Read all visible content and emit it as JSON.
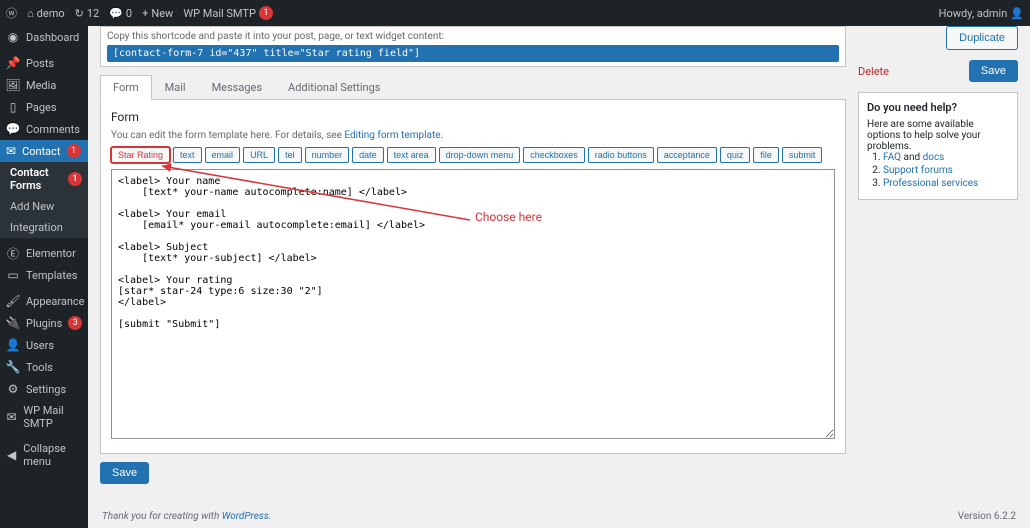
{
  "adminbar": {
    "site": "demo",
    "updates": "12",
    "comments": "0",
    "new": "New",
    "smtp": "WP Mail SMTP",
    "smtp_badge": "1",
    "howdy": "Howdy, admin"
  },
  "sidebar": {
    "items": [
      {
        "icon": "⌂",
        "label": "Dashboard"
      },
      {
        "icon": "✎",
        "label": "Posts"
      },
      {
        "icon": "▤",
        "label": "Media"
      },
      {
        "icon": "▯",
        "label": "Pages"
      },
      {
        "icon": "✉",
        "label": "Comments"
      },
      {
        "icon": "✉",
        "label": "Contact",
        "badge": "1",
        "active": true
      },
      {
        "icon": "Ⓔ",
        "label": "Elementor"
      },
      {
        "icon": "▭",
        "label": "Templates"
      },
      {
        "icon": "✐",
        "label": "Appearance"
      },
      {
        "icon": "⚙",
        "label": "Plugins",
        "badge": "3"
      },
      {
        "icon": "👤",
        "label": "Users"
      },
      {
        "icon": "🔧",
        "label": "Tools"
      },
      {
        "icon": "⚙",
        "label": "Settings"
      },
      {
        "icon": "✉",
        "label": "WP Mail SMTP"
      },
      {
        "icon": "◀",
        "label": "Collapse menu"
      }
    ],
    "submenu": {
      "title": "Contact Forms",
      "badge": "1",
      "items": [
        "Add New",
        "Integration"
      ]
    }
  },
  "shortcode": {
    "hint": "Copy this shortcode and paste it into your post, page, or text widget content:",
    "value": "[contact-form-7 id=\"437\" title=\"Star rating field\"]"
  },
  "tabs": [
    "Form",
    "Mail",
    "Messages",
    "Additional Settings"
  ],
  "form": {
    "heading": "Form",
    "hint_pre": "You can edit the form template here. For details, see ",
    "hint_link": "Editing form template",
    "tags": [
      "Star Rating",
      "text",
      "email",
      "URL",
      "tel",
      "number",
      "date",
      "text area",
      "drop-down menu",
      "checkboxes",
      "radio buttons",
      "acceptance",
      "quiz",
      "file",
      "submit"
    ],
    "content": "<label> Your name\n    [text* your-name autocomplete:name] </label>\n\n<label> Your email\n    [email* your-email autocomplete:email] </label>\n\n<label> Subject\n    [text* your-subject] </label>\n\n<label> Your rating\n[star* star-24 type:6 size:30 \"2\"]\n</label>\n\n[submit \"Submit\"]"
  },
  "save": "Save",
  "right": {
    "duplicate": "Duplicate",
    "delete": "Delete",
    "save": "Save",
    "help_title": "Do you need help?",
    "help_text": "Here are some available options to help solve your problems.",
    "links": [
      "FAQ",
      "docs",
      "Support forums",
      "Professional services"
    ],
    "and": " and "
  },
  "annotation": "Choose here",
  "footer": {
    "thank": "Thank you for creating with ",
    "wp": "WordPress",
    "version": "Version 6.2.2"
  }
}
